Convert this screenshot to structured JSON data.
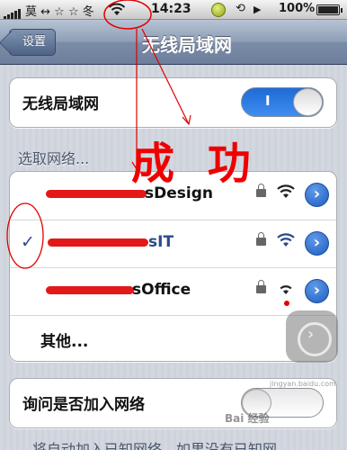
{
  "status_bar": {
    "carrier": "莫 ↔ ☆ ☆ 冬",
    "time": "14:23",
    "battery_pct": "100%",
    "battery_level": 1.0
  },
  "nav": {
    "back_label": "设置",
    "title": "无线局域网"
  },
  "wifi_toggle": {
    "label": "无线局域网",
    "state_text": "I",
    "on": true
  },
  "section_header": "选取网络...",
  "networks": [
    {
      "name": "sDesign",
      "selected": false,
      "locked": true
    },
    {
      "name": "sIT",
      "selected": true,
      "locked": true
    },
    {
      "name": "sOffice",
      "selected": false,
      "locked": true
    }
  ],
  "other_label": "其他...",
  "ask_toggle": {
    "label": "询问是否加入网络",
    "on": false
  },
  "footer": "将自动加入已知网络。如果没有已知网",
  "annotation": {
    "text": "成 功",
    "color": "#ee0000"
  },
  "watermark": {
    "brand": "Bai 经验",
    "url": "jingyan.baidu.com"
  },
  "colors": {
    "accent": "#1f5dc0",
    "toggle_on": "#2f7ce6",
    "navbar": "#7a8ca7"
  },
  "icons": {
    "back": "chevron-left-icon",
    "lock": "lock-icon",
    "wifi": "wifi-icon",
    "disclosure": "detail-disclosure-icon",
    "check": "checkmark-icon",
    "assistive": "assistive-touch-icon"
  }
}
